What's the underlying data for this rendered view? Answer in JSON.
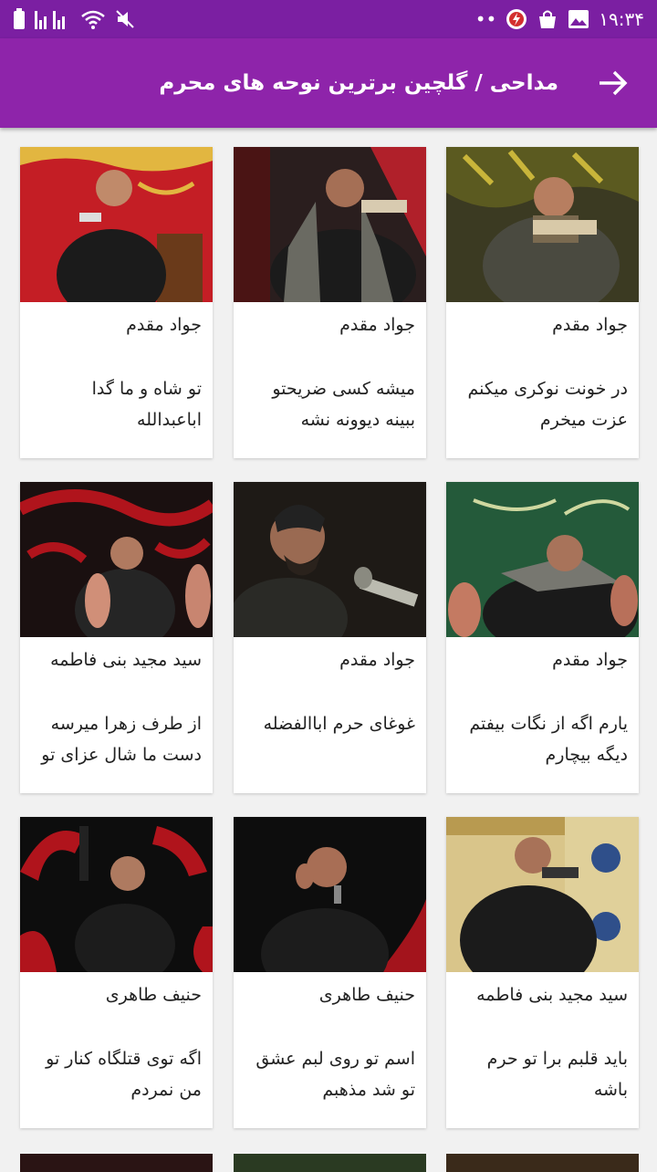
{
  "status_bar": {
    "time": "۱۹:۳۴",
    "dots": "••",
    "icons": [
      "image-icon",
      "bag-icon",
      "power-icon",
      "battery-icon",
      "signal-icon",
      "wifi-icon",
      "mute-icon"
    ]
  },
  "app_bar": {
    "title": "مداحی / گلچین برترین نوحه های محرم",
    "back_icon": "arrow-right-icon"
  },
  "colors": {
    "status_bar": "#7b1fa2",
    "app_bar": "#8e24aa",
    "background": "#f1f1f1",
    "card": "#ffffff"
  },
  "cards": [
    {
      "singer": "جواد مقدم",
      "title": "در خونت نوکری میکنم عزت میخرم",
      "thumb": "reciter-photo-green-flag"
    },
    {
      "singer": "جواد مقدم",
      "title": "میشه کسی ضریحتو ببینه دیوونه نشه",
      "thumb": "reciter-photo-red-curtain"
    },
    {
      "singer": "جواد مقدم",
      "title": "تو شاه و ما گدا اباعبدالله",
      "thumb": "reciter-photo-red-stage"
    },
    {
      "singer": "جواد مقدم",
      "title": "یارم اگه از نگات بیفتم دیگه بیچارم",
      "thumb": "reciter-photo-green-banner"
    },
    {
      "singer": "جواد مقدم",
      "title": "غوغای حرم اباالفضله",
      "thumb": "reciter-photo-dark"
    },
    {
      "singer": "سید مجید بنی فاطمه",
      "title": "از طرف زهرا میرسه دست ما شال عزای تو",
      "thumb": "reciter-photo-red-black"
    },
    {
      "singer": "سید مجید بنی فاطمه",
      "title": "باید قلبم برا تو حرم باشه",
      "thumb": "reciter-photo-tiles"
    },
    {
      "singer": "حنیف طاهری",
      "title": "اسم تو روی لبم عشق تو شد مذهبم",
      "thumb": "reciter-photo-black"
    },
    {
      "singer": "حنیف طاهری",
      "title": "اگه توی قتلگاه کنار تو من نمردم",
      "thumb": "reciter-photo-red-arcs"
    }
  ]
}
